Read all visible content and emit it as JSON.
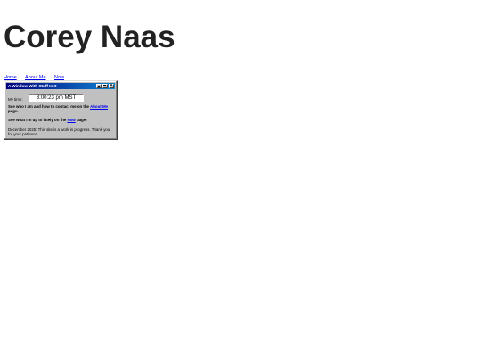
{
  "site": {
    "title": "Corey Naas"
  },
  "nav": {
    "items": [
      {
        "label": "Home"
      },
      {
        "label": "About Me"
      },
      {
        "label": "Now"
      }
    ]
  },
  "window": {
    "title": "A Window With Stuff In It",
    "time_label": "My time:",
    "time_value": "3:00:23 pm MST",
    "contact": {
      "prefix": "See who I am and how to contact me on the ",
      "link": "About Me",
      "suffix": " page."
    },
    "lately": {
      "prefix": "See what I'm up to lately on the ",
      "link": "Now",
      "suffix": " page!"
    },
    "notice": "December 2025: This site is a work in progress. Thank you for your patience."
  }
}
